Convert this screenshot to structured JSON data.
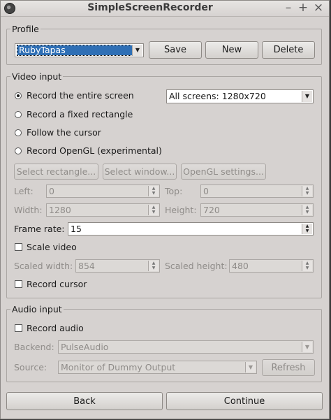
{
  "window": {
    "title": "SimpleScreenRecorder"
  },
  "profile": {
    "legend": "Profile",
    "selected": "RubyTapas",
    "save_label": "Save",
    "new_label": "New",
    "delete_label": "Delete"
  },
  "video": {
    "legend": "Video input",
    "options": {
      "entire": "Record the entire screen",
      "rect": "Record a fixed rectangle",
      "follow": "Follow the cursor",
      "opengl": "Record OpenGL (experimental)"
    },
    "screen_select": "All screens: 1280x720",
    "select_rect_label": "Select rectangle...",
    "select_window_label": "Select window...",
    "opengl_settings_label": "OpenGL settings...",
    "left_label": "Left:",
    "left_value": "0",
    "top_label": "Top:",
    "top_value": "0",
    "width_label": "Width:",
    "width_value": "1280",
    "height_label": "Height:",
    "height_value": "720",
    "frame_rate_label": "Frame rate:",
    "frame_rate_value": "15",
    "scale_video_label": "Scale video",
    "scaled_width_label": "Scaled width:",
    "scaled_width_value": "854",
    "scaled_height_label": "Scaled height:",
    "scaled_height_value": "480",
    "record_cursor_label": "Record cursor"
  },
  "audio": {
    "legend": "Audio input",
    "record_audio_label": "Record audio",
    "backend_label": "Backend:",
    "backend_value": "PulseAudio",
    "source_label": "Source:",
    "source_value": "Monitor of Dummy Output",
    "refresh_label": "Refresh"
  },
  "footer": {
    "back_label": "Back",
    "continue_label": "Continue"
  }
}
